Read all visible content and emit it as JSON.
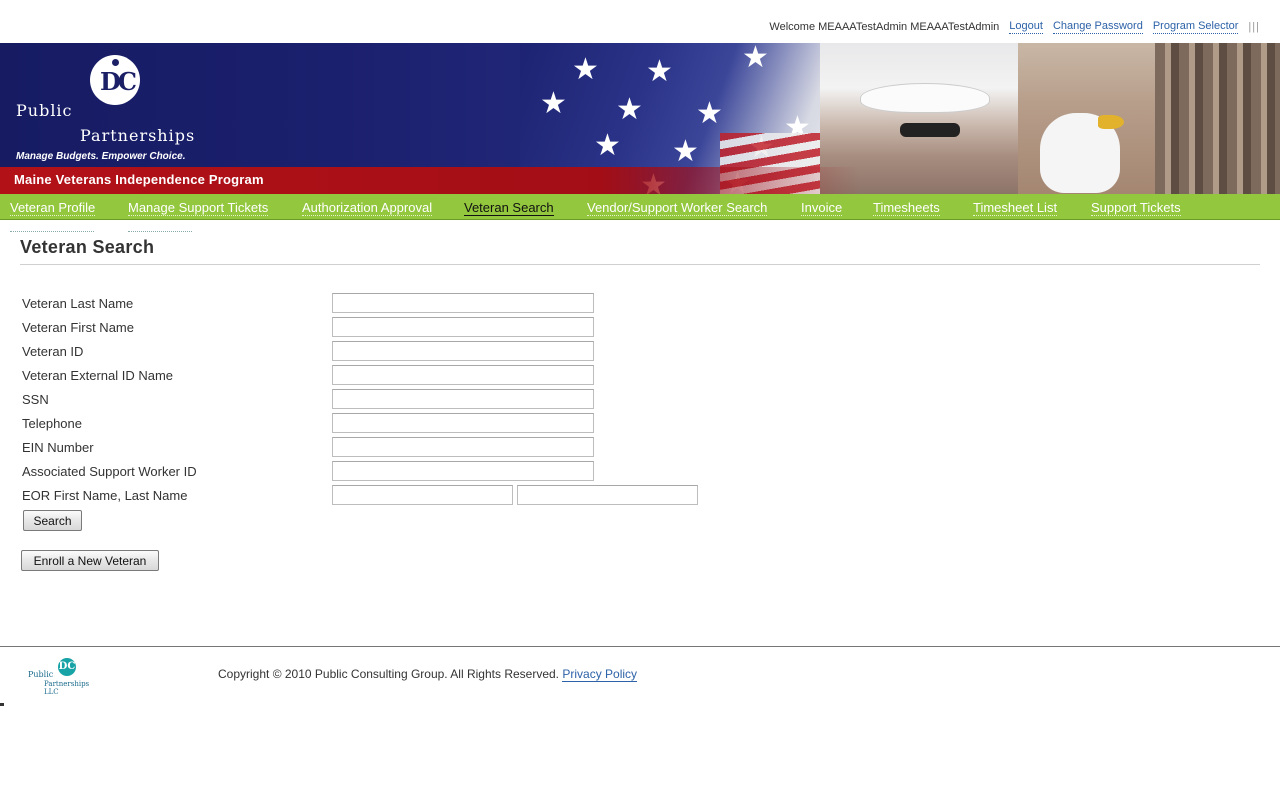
{
  "header": {
    "welcome_text": "Welcome MEAAATestAdmin MEAAATestAdmin",
    "links": {
      "logout": "Logout",
      "change_password": "Change Password",
      "program_selector": "Program Selector"
    },
    "bars_glyph": "|||"
  },
  "banner": {
    "logo": {
      "line1": "Public",
      "line2": "Partnerships",
      "tagline": "Manage Budgets. Empower Choice.",
      "mark": "DC"
    },
    "program_title": "Maine Veterans Independence Program",
    "colors": {
      "navy": "#1a1f66",
      "red": "#b31118"
    }
  },
  "nav": {
    "items": [
      {
        "label": "Veteran Profile"
      },
      {
        "label": "Manage Support Tickets"
      },
      {
        "label": "Authorization Approval"
      },
      {
        "label": "Veteran Search",
        "active": true
      },
      {
        "label": "Vendor/Support Worker Search"
      },
      {
        "label": "Invoice"
      },
      {
        "label": "Timesheets"
      },
      {
        "label": "Timesheet List"
      },
      {
        "label": "Support Tickets"
      }
    ],
    "color": "#93c73d"
  },
  "main": {
    "title": "Veteran Search",
    "fields": {
      "last_name": "Veteran Last Name",
      "first_name": "Veteran First Name",
      "veteran_id": "Veteran ID",
      "external_id": "Veteran External ID Name",
      "ssn": "SSN",
      "telephone": "Telephone",
      "ein": "EIN Number",
      "support_worker_id": "Associated Support Worker ID",
      "eor_name": "EOR First Name, Last Name"
    },
    "buttons": {
      "search": "Search",
      "enroll": "Enroll a New Veteran"
    }
  },
  "footer": {
    "logo": {
      "line1": "Public",
      "line2": "Partnerships LLC",
      "mark": "DC"
    },
    "copyright": "Copyright © 2010 Public Consulting Group. All Rights Reserved.",
    "privacy_link": "Privacy Policy"
  }
}
